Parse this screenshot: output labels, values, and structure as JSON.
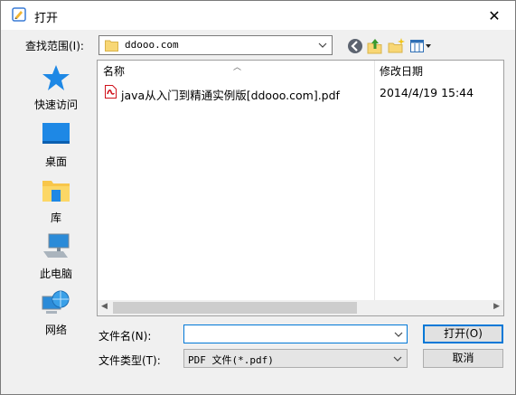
{
  "window": {
    "title": "打开",
    "close_glyph": "✕"
  },
  "toolbar": {
    "look_in_label": "查找范围(I):",
    "look_in_value": "ddooo.com",
    "icons": [
      "back-icon",
      "up-folder-icon",
      "new-folder-icon",
      "view-menu-icon"
    ]
  },
  "nav": {
    "items": [
      {
        "label": "快速访问",
        "icon": "star-icon"
      },
      {
        "label": "桌面",
        "icon": "desktop-icon"
      },
      {
        "label": "库",
        "icon": "library-icon"
      },
      {
        "label": "此电脑",
        "icon": "computer-icon"
      },
      {
        "label": "网络",
        "icon": "network-icon"
      }
    ]
  },
  "list": {
    "columns": {
      "name": "名称",
      "date": "修改日期"
    },
    "files": [
      {
        "name": "java从入门到精通实例版[ddooo.com].pdf",
        "date": "2014/4/19 15:44",
        "icon": "pdf-icon"
      }
    ]
  },
  "footer": {
    "filename_label": "文件名(N):",
    "filename_value": "",
    "filetype_label": "文件类型(T):",
    "filetype_value": "PDF 文件(*.pdf)",
    "open_label": "打开(O)",
    "cancel_label": "取消"
  },
  "colors": {
    "accent": "#0078d7",
    "folder": "#f8d775",
    "pdf": "#d0121b"
  }
}
